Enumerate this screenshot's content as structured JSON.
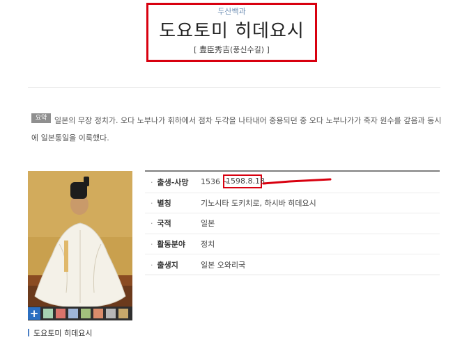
{
  "header": {
    "source": "두산백과",
    "title": "도요토미 히데요시",
    "hanja": "[ 豊臣秀吉(풍신수길) ]"
  },
  "summary": {
    "badge": "요약",
    "text": "일본의 무장 정치가. 오다 노부나가 휘하에서 점차 두각을 나타내어 중용되던 중 오다 노부나가가 죽자 원수를 갚음과 동시에 일본통일을 이룩했다."
  },
  "image": {
    "plus_label": "+",
    "caption": "도요토미 히데요시"
  },
  "info": {
    "rows": [
      {
        "label": "출생-사망",
        "value": "1536 ~",
        "value2": "1598.8.18"
      },
      {
        "label": "별칭",
        "value": "기노시타 도키치로, 하시바 히데요시"
      },
      {
        "label": "국적",
        "value": "일본"
      },
      {
        "label": "활동분야",
        "value": "정치"
      },
      {
        "label": "출생지",
        "value": "일본 오와리국"
      }
    ]
  },
  "colors": {
    "highlight": "#d8000f",
    "source_link": "#6f8fb5",
    "plus_button": "#2b6fc1"
  }
}
